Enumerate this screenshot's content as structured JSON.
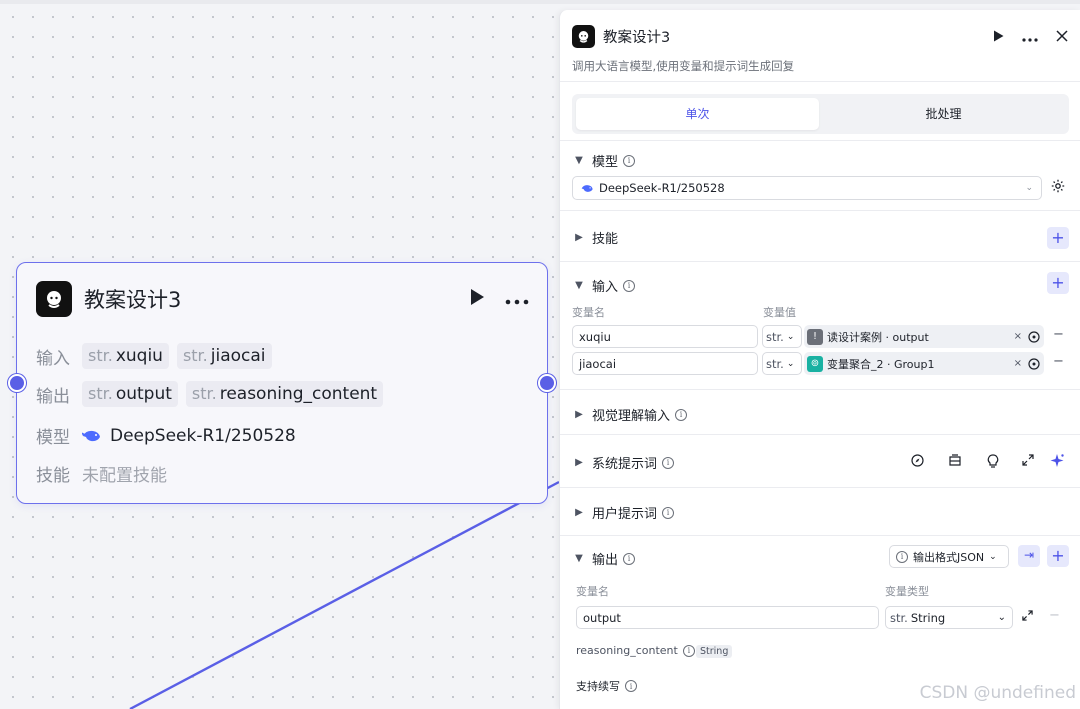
{
  "node": {
    "title": "教案设计3",
    "input_label": "输入",
    "output_label": "输出",
    "model_label": "模型",
    "skill_label": "技能",
    "type_prefix": "str.",
    "inputs": [
      "xuqiu",
      "jiaocai"
    ],
    "outputs": [
      "output",
      "reasoning_content"
    ],
    "model": "DeepSeek-R1/250528",
    "skill_value": "未配置技能"
  },
  "panel": {
    "title": "教案设计3",
    "description": "调用大语言模型,使用变量和提示词生成回复",
    "tabs": {
      "single": "单次",
      "batch": "批处理"
    },
    "model_section": {
      "label": "模型",
      "selected": "DeepSeek-R1/250528"
    },
    "skills_section": {
      "label": "技能"
    },
    "input_section": {
      "label": "输入",
      "col_name": "变量名",
      "col_value": "变量值",
      "rows": [
        {
          "name": "xuqiu",
          "type": "str.",
          "ref": "读设计案例 · output",
          "ref_color": "#6b6f78"
        },
        {
          "name": "jiaocai",
          "type": "str.",
          "ref": "变量聚合_2 · Group1",
          "ref_color": "#19b1a2"
        }
      ]
    },
    "vision_section": {
      "label": "视觉理解输入"
    },
    "system_prompt_section": {
      "label": "系统提示词"
    },
    "user_prompt_section": {
      "label": "用户提示词"
    },
    "output_section": {
      "label": "输出",
      "format_label": "输出格式JSON",
      "col_name": "变量名",
      "col_type": "变量类型",
      "row_name": "output",
      "row_type_prefix": "str.",
      "row_type": "String",
      "reasoning_name": "reasoning_content",
      "reasoning_type": "String",
      "continue_label": "支持续写"
    }
  },
  "watermark": "CSDN @undefined",
  "colors": {
    "accent": "#4d53e8",
    "edge": "#5a5fe6",
    "node_border": "#6d70ec"
  }
}
